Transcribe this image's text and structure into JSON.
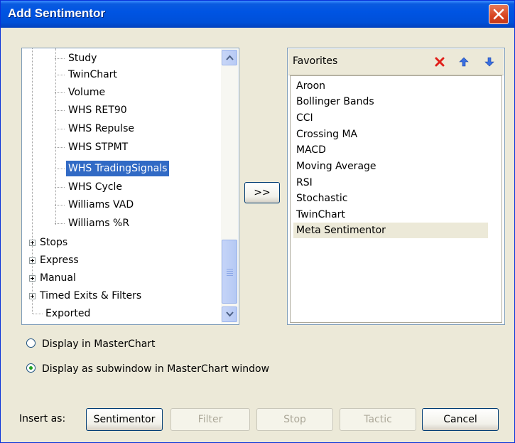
{
  "window": {
    "title": "Add Sentimentor",
    "close_icon": "close-icon"
  },
  "tree": {
    "items": [
      {
        "label": "Study",
        "level": 2,
        "selected": false
      },
      {
        "label": "TwinChart",
        "level": 2,
        "selected": false
      },
      {
        "label": "Volume",
        "level": 2,
        "selected": false
      },
      {
        "label": "WHS RET90",
        "level": 2,
        "selected": false
      },
      {
        "label": "WHS Repulse",
        "level": 2,
        "selected": false
      },
      {
        "label": "WHS STPMT",
        "level": 2,
        "selected": false
      },
      {
        "label": "WHS TradingSignals",
        "level": 2,
        "selected": true
      },
      {
        "label": "WHS Cycle",
        "level": 2,
        "selected": false
      },
      {
        "label": "Williams VAD",
        "level": 2,
        "selected": false
      },
      {
        "label": "Williams %R",
        "level": 2,
        "selected": false
      },
      {
        "label": "Stops",
        "level": 1,
        "expandable": true
      },
      {
        "label": "Express",
        "level": 1,
        "expandable": true
      },
      {
        "label": "Manual",
        "level": 1,
        "expandable": true
      },
      {
        "label": "Timed Exits & Filters",
        "level": 1,
        "expandable": true
      },
      {
        "label": "Exported",
        "level": 1,
        "expandable": false
      }
    ]
  },
  "move_button": {
    "label": ">>"
  },
  "favorites": {
    "title": "Favorites",
    "toolbar_icons": [
      "delete-icon",
      "move-up-icon",
      "move-down-icon"
    ],
    "items": [
      {
        "label": "Aroon",
        "active": false
      },
      {
        "label": "Bollinger Bands",
        "active": false
      },
      {
        "label": "CCI",
        "active": false
      },
      {
        "label": "Crossing MA",
        "active": false
      },
      {
        "label": "MACD",
        "active": false
      },
      {
        "label": "Moving Average",
        "active": false
      },
      {
        "label": "RSI",
        "active": false
      },
      {
        "label": "Stochastic",
        "active": false
      },
      {
        "label": "TwinChart",
        "active": false
      },
      {
        "label": "Meta Sentimentor",
        "active": true
      }
    ]
  },
  "display_options": [
    {
      "label": "Display in MasterChart",
      "checked": false
    },
    {
      "label": "Display as subwindow in MasterChart window",
      "checked": true
    }
  ],
  "insert": {
    "label": "Insert as:",
    "buttons": [
      {
        "label": "Sentimentor",
        "enabled": true
      },
      {
        "label": "Filter",
        "enabled": false
      },
      {
        "label": "Stop",
        "enabled": false
      },
      {
        "label": "Tactic",
        "enabled": false
      },
      {
        "label": "Cancel",
        "enabled": true
      }
    ]
  },
  "colors": {
    "title_bar": "#0054e3",
    "selection": "#316ac5",
    "dialog_bg": "#ece9d8"
  }
}
